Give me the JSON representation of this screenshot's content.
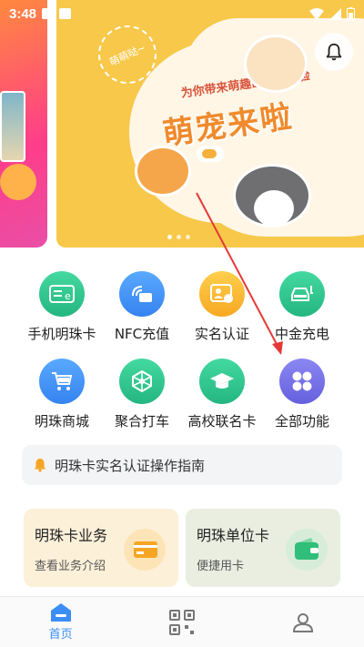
{
  "status_bar": {
    "time": "3:48"
  },
  "banner": {
    "tag": "萌萌哒~",
    "tagline": "为你带来萌趣出行新体验",
    "title": "萌宠来啦",
    "page_count": 3,
    "active_page": 1
  },
  "grid": {
    "items": [
      {
        "label": "手机明珠卡",
        "icon": "card-e-icon",
        "color": "green"
      },
      {
        "label": "NFC充值",
        "icon": "nfc-wallet-icon",
        "color": "blue"
      },
      {
        "label": "实名认证",
        "icon": "id-card-icon",
        "color": "orange"
      },
      {
        "label": "中金充电",
        "icon": "car-charging-icon",
        "color": "green"
      },
      {
        "label": "明珠商城",
        "icon": "cart-icon",
        "color": "blue"
      },
      {
        "label": "聚合打车",
        "icon": "network-icon",
        "color": "green"
      },
      {
        "label": "高校联名卡",
        "icon": "graduation-cap-icon",
        "color": "green"
      },
      {
        "label": "全部功能",
        "icon": "four-circles-icon",
        "color": "purple"
      }
    ]
  },
  "notice": {
    "text": "明珠卡实名认证操作指南"
  },
  "cards": [
    {
      "title": "明珠卡业务",
      "subtitle": "查看业务介绍"
    },
    {
      "title": "明珠单位卡",
      "subtitle": "便捷用卡"
    }
  ],
  "bottom_nav": {
    "items": [
      {
        "label": "首页",
        "icon": "home-icon",
        "active": true
      },
      {
        "label": "",
        "icon": "qr-code-icon",
        "active": false
      },
      {
        "label": "",
        "icon": "profile-icon",
        "active": false
      }
    ]
  },
  "colors": {
    "accent": "#3a8ef6",
    "annotation": "#e53935",
    "banner": "#f7c84a"
  }
}
